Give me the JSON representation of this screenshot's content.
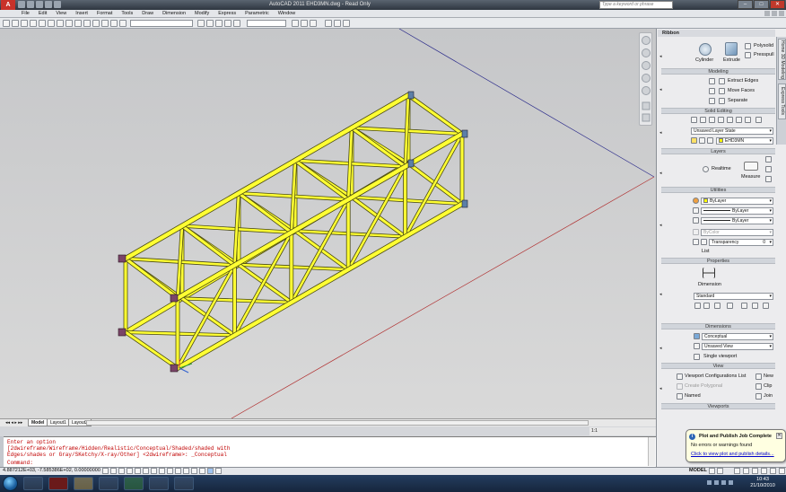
{
  "titlebar": {
    "app_logo": "A",
    "title": "AutoCAD 2011   EHD3MN.dwg - Read Only",
    "search_placeholder": "Type a keyword or phrase",
    "min": "–",
    "max": "□",
    "close": "✕"
  },
  "menu": [
    "File",
    "Edit",
    "View",
    "Insert",
    "Format",
    "Tools",
    "Draw",
    "Dimension",
    "Modify",
    "Express",
    "Parametric",
    "Window"
  ],
  "layout_tabs": [
    {
      "label": "Model",
      "active": true
    },
    {
      "label": "Layout1",
      "active": false
    },
    {
      "label": "Layout2",
      "active": false
    }
  ],
  "command": {
    "lines": [
      "Enter an option",
      "[2dwireframe/Wireframe/Hidden/Realistic/Conceptual/Shaded/shaded with",
      "Edges/shades or Gray/SKetchy/X-ray/Other] <2dwireframe>: _Conceptual"
    ],
    "prompt": "Command:"
  },
  "status": {
    "coords": "4.887212E+03, -7.585386E+02, 0.00000000",
    "model_label": "MODEL",
    "annoscale": "1:1"
  },
  "ribbon": {
    "title": "Ribbon",
    "vtabs": [
      "Home 3D Modeling",
      "Express Tools"
    ],
    "modeling": {
      "cylinder": "Cylinder",
      "extrude": "Extrude",
      "polysolid": "Polysolid",
      "presspull": "Presspull",
      "panel": "Modeling"
    },
    "solid_editing": {
      "extract_edges": "Extract Edges",
      "move_faces": "Move Faces",
      "separate": "Separate",
      "panel": "Solid Editing"
    },
    "layers": {
      "layer_state": "Unsaved Layer State",
      "layer_name": "EHD3MN",
      "panel": "Layers"
    },
    "utilities": {
      "realtime": "Realtime",
      "measure": "Measure",
      "panel": "Utilities"
    },
    "properties": {
      "color": "ByLayer",
      "linetype": "ByLayer",
      "lineweight": "ByLayer",
      "plotstyle": "ByColor",
      "transparency_label": "Transparency",
      "transparency_value": "0",
      "list": "List",
      "panel": "Properties"
    },
    "dimensions": {
      "dimension": "Dimension",
      "style": "Standard",
      "panel": "Dimensions"
    },
    "view": {
      "visual_style": "Conceptual",
      "named_view": "Unsaved View",
      "viewport": "Single viewport",
      "panel": "View"
    },
    "viewports": {
      "config_list": "Viewport Configurations List",
      "create_polygonal": "Create Polygonal",
      "named": "Named",
      "new": "New",
      "clip": "Clip",
      "join": "Join",
      "panel": "Viewports"
    }
  },
  "notification": {
    "title": "Plot and Publish Job Complete",
    "message": "No errors or warnings found",
    "link": "Click to view plot and publish details..."
  },
  "taskbar": {
    "time": "10:43",
    "date": "21/10/2010"
  },
  "colors": {
    "truss": "#ffff33",
    "truss_edge": "#4a4a10",
    "connector": "#7a4468",
    "command_text": "#c00000"
  }
}
